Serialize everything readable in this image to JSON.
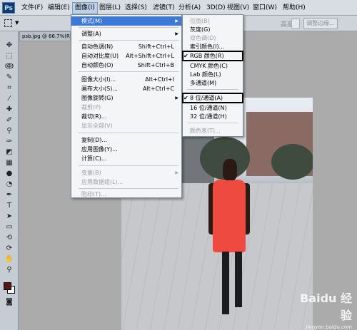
{
  "app": {
    "logo": "Ps"
  },
  "menubar": {
    "items": [
      "文件(F)",
      "编辑(E)",
      "图像(I)",
      "图层(L)",
      "选择(S)",
      "滤镜(T)",
      "分析(A)",
      "3D(D)",
      "视图(V)",
      "窗口(W)",
      "帮助(H)"
    ],
    "active_index": 2
  },
  "optionsbar": {
    "height_label": "高度:",
    "refine_edge_label": "调整边缘..."
  },
  "document": {
    "tab_title": "psb.jpg @ 66.7%(RGB"
  },
  "toolbox": {
    "icons": [
      "move-icon",
      "marquee-icon",
      "lasso-icon",
      "quick-select-icon",
      "crop-icon",
      "eyedropper-icon",
      "healing-brush-icon",
      "brush-icon",
      "clone-stamp-icon",
      "history-brush-icon",
      "eraser-icon",
      "gradient-icon",
      "blur-icon",
      "dodge-icon",
      "pen-icon",
      "type-icon",
      "path-select-icon",
      "shape-icon",
      "3d-rotate-icon",
      "3d-orbit-icon",
      "hand-icon",
      "zoom-icon",
      "quick-mask-icon"
    ],
    "foreground_color": "#5a1518",
    "background_color": "#ffffff"
  },
  "image_menu": {
    "items": [
      {
        "label": "模式(M)",
        "shortcut": "",
        "submenu": true,
        "disabled": false,
        "highlighted": true
      },
      {
        "label": "调整(A)",
        "shortcut": "",
        "submenu": true,
        "disabled": false
      },
      {
        "label": "自动色调(N)",
        "shortcut": "Shift+Ctrl+L",
        "disabled": false
      },
      {
        "label": "自动对比度(U)",
        "shortcut": "Alt+Shift+Ctrl+L",
        "disabled": false
      },
      {
        "label": "自动颜色(O)",
        "shortcut": "Shift+Ctrl+B",
        "disabled": false
      },
      {
        "label": "图像大小(I)...",
        "shortcut": "Alt+Ctrl+I",
        "disabled": false
      },
      {
        "label": "画布大小(S)...",
        "shortcut": "Alt+Ctrl+C",
        "disabled": false
      },
      {
        "label": "图像旋转(G)",
        "shortcut": "",
        "submenu": true,
        "disabled": false
      },
      {
        "label": "裁剪(P)",
        "shortcut": "",
        "disabled": true
      },
      {
        "label": "裁切(R)...",
        "shortcut": "",
        "disabled": false
      },
      {
        "label": "显示全部(V)",
        "shortcut": "",
        "disabled": true
      },
      {
        "label": "复制(D)...",
        "shortcut": "",
        "disabled": false
      },
      {
        "label": "应用图像(Y)...",
        "shortcut": "",
        "disabled": false
      },
      {
        "label": "计算(C)...",
        "shortcut": "",
        "disabled": false
      },
      {
        "label": "变量(B)",
        "shortcut": "",
        "submenu": true,
        "disabled": true
      },
      {
        "label": "应用数据组(L)...",
        "shortcut": "",
        "disabled": true
      },
      {
        "label": "陷印(T)...",
        "shortcut": "",
        "disabled": true
      }
    ]
  },
  "mode_menu": {
    "items": [
      {
        "label": "位图(B)",
        "disabled": true
      },
      {
        "label": "灰度(G)",
        "disabled": false
      },
      {
        "label": "双色调(D)",
        "disabled": true
      },
      {
        "label": "索引颜色(I)...",
        "disabled": false
      },
      {
        "label": "RGB 颜色(R)",
        "disabled": false,
        "checked": true,
        "boxed": true
      },
      {
        "label": "CMYK 颜色(C)",
        "disabled": false
      },
      {
        "label": "Lab 颜色(L)",
        "disabled": false
      },
      {
        "label": "多通道(M)",
        "disabled": false
      },
      {
        "label": "8 位/通道(A)",
        "disabled": false,
        "checked": true,
        "boxed": true
      },
      {
        "label": "16 位/通道(N)",
        "disabled": false
      },
      {
        "label": "32 位/通道(H)",
        "disabled": false
      },
      {
        "label": "颜色表(T)...",
        "disabled": true
      }
    ]
  },
  "watermark": {
    "text": "Baidu 经验",
    "url": "jingyan.baidu.com"
  }
}
